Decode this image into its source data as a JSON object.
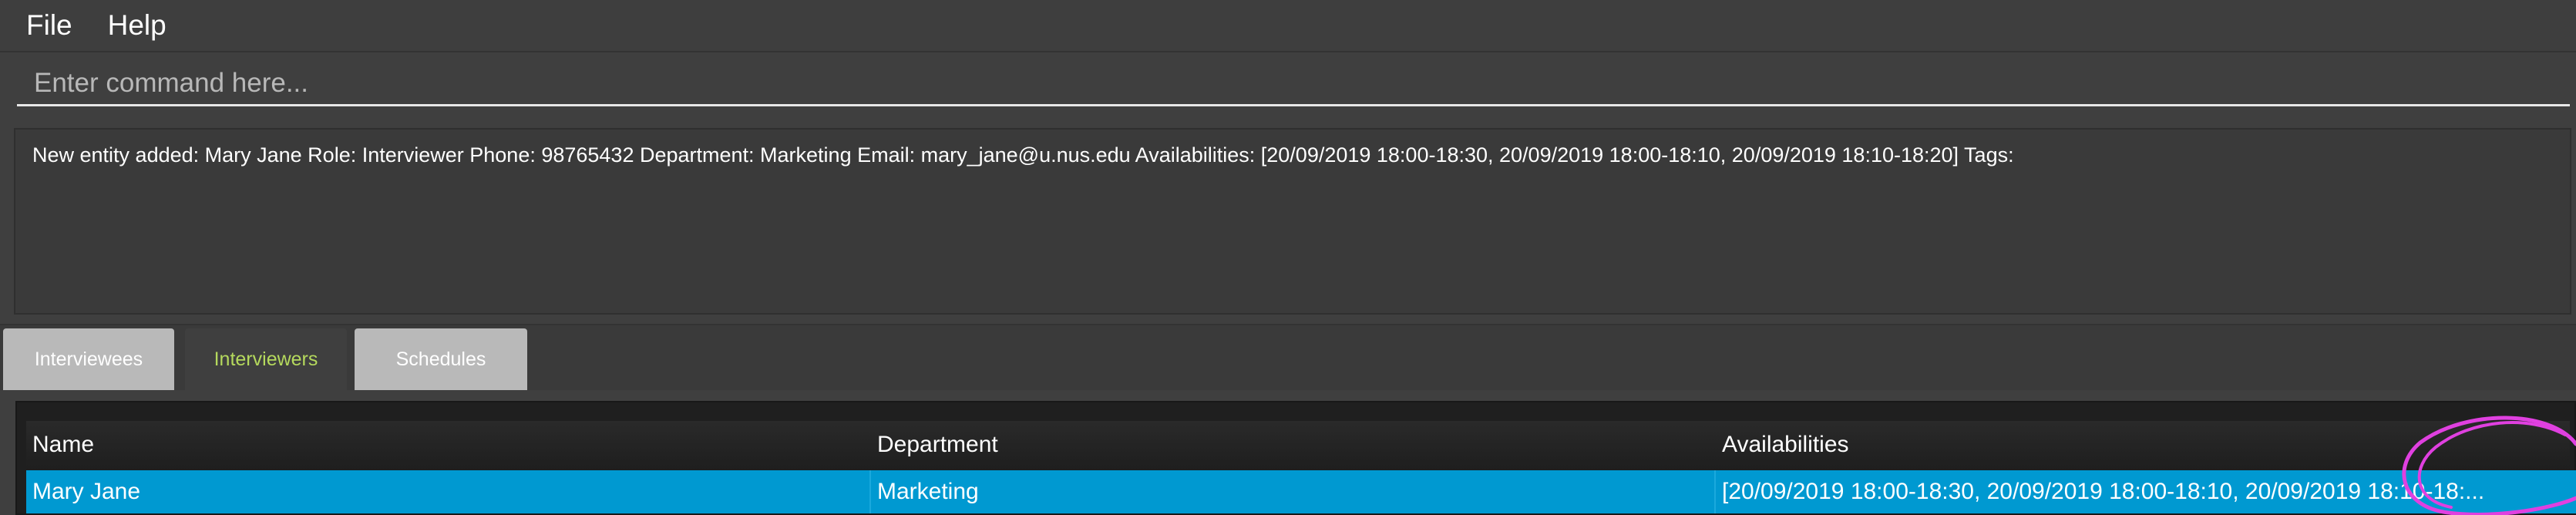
{
  "menu": {
    "file": "File",
    "help": "Help"
  },
  "command": {
    "placeholder": "Enter command here...",
    "value": ""
  },
  "result": {
    "text": "New entity added: Mary Jane Role: Interviewer Phone: 98765432 Department: Marketing Email: mary_jane@u.nus.edu Availabilities: [20/09/2019 18:00-18:30, 20/09/2019 18:00-18:10, 20/09/2019 18:10-18:20] Tags:"
  },
  "tabs": [
    {
      "label": "Interviewees",
      "active": false
    },
    {
      "label": "Interviewers",
      "active": true
    },
    {
      "label": "Schedules",
      "active": false
    }
  ],
  "table": {
    "columns": [
      "Name",
      "Department",
      "Availabilities"
    ],
    "rows": [
      {
        "name": "Mary Jane",
        "department": "Marketing",
        "availabilities": "[20/09/2019 18:00-18:30, 20/09/2019 18:00-18:10, 20/09/2019 18:10-18:..."
      }
    ]
  },
  "colors": {
    "background": "#3f3f3f",
    "selected_row": "#0099d1",
    "active_tab_text": "#b5d95d",
    "inactive_tab": "#b9b9b9",
    "annotation": "#e040e0"
  }
}
